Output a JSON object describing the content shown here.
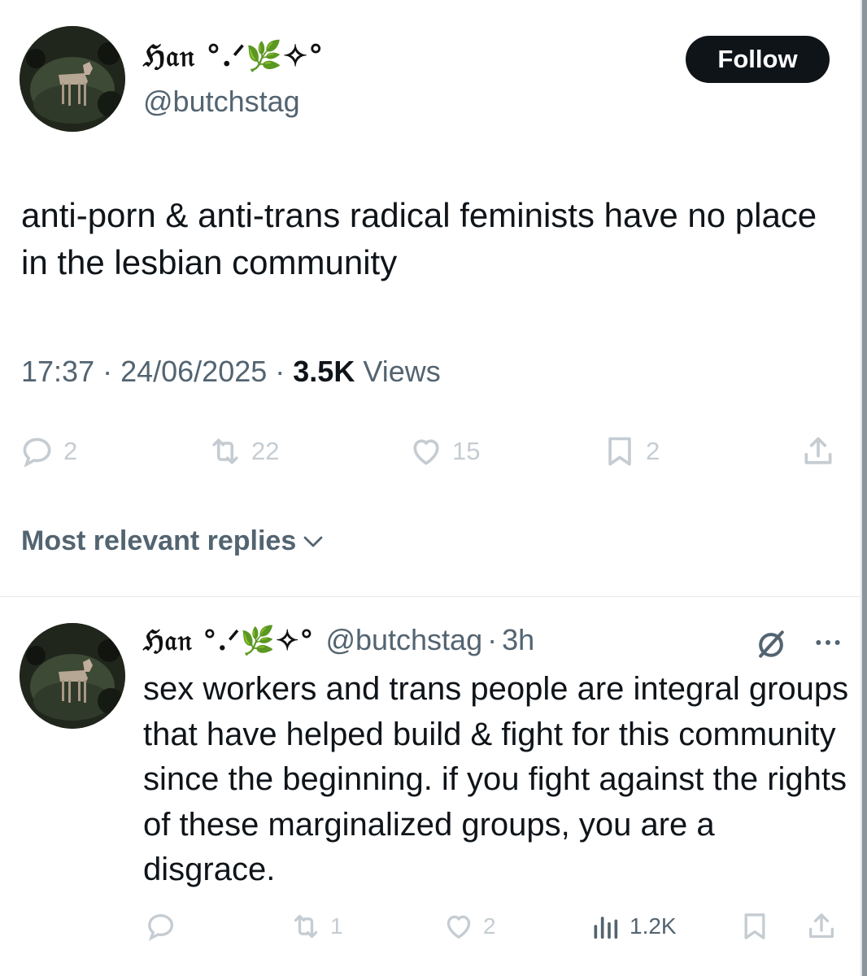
{
  "tweet": {
    "display_name": "ℌ𝔞𝔫 °.ᐟ🌿✧°",
    "handle": "@butchstag",
    "follow_label": "Follow",
    "text": "anti-porn & anti-trans radical feminists have no place in the lesbian community",
    "time": "17:37",
    "date": "24/06/2025",
    "views_count": "3.5K",
    "views_label": "Views",
    "separator": " · ",
    "actions": {
      "replies": "2",
      "reposts": "22",
      "likes": "15",
      "bookmarks": "2"
    }
  },
  "replies_section": {
    "heading": "Most relevant replies"
  },
  "reply": {
    "display_name": "ℌ𝔞𝔫 °.ᐟ🌿✧°",
    "handle": "@butchstag",
    "dot": "·",
    "time": "3h",
    "text": "sex workers and trans people are integral groups that have helped build & fight for this community since the beginning. if you fight against the rights of these marginalized groups, you are a disgrace.",
    "actions": {
      "reposts": "1",
      "likes": "2",
      "views": "1.2K"
    }
  },
  "icons": {
    "reply": "speech-bubble-icon",
    "repost": "repost-arrows-icon",
    "like": "heart-icon",
    "bookmark": "bookmark-icon",
    "share": "share-upload-icon",
    "views": "bar-chart-icon",
    "grok": "slashed-circle-icon",
    "more": "ellipsis-icon",
    "chevron": "chevron-down-icon"
  },
  "colors": {
    "text_primary": "#0f1419",
    "text_secondary": "#536471",
    "icon_muted": "#c5ccd2",
    "button_bg": "#0f1419",
    "button_text": "#ffffff"
  }
}
